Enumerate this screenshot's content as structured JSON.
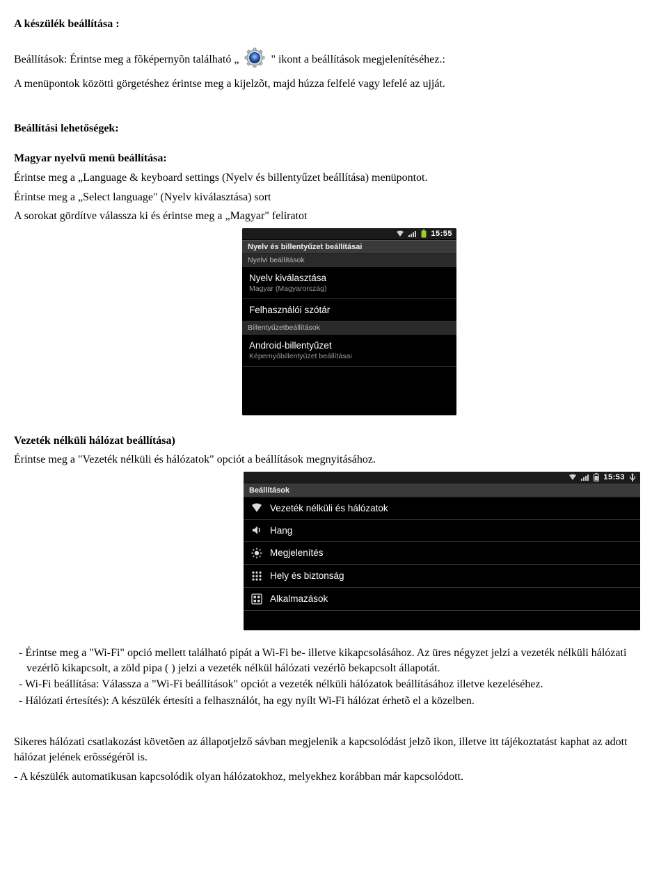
{
  "doc": {
    "h1": "A készülék beállítása :",
    "intro_pre": "Beállítások: Érintse meg a fõképernyõn található „",
    "intro_post": "\" ikont a beállítások megjelenítéséhez.:",
    "p2": "A menüpontok közötti görgetéshez érintse meg a kijelzõt, majd húzza felfelé vagy lefelé az ujját.",
    "h2": "Beállítási lehetőségek:",
    "h3a": "Magyar nyelvű menü beállítása:",
    "p3": "Érintse meg a „Language & keyboard settings (Nyelv és billentyűzet beállítása) menüpontot.",
    "p4": "Érintse meg a „Select language\" (Nyelv kiválasztása) sort",
    "p5": "A sorokat gördítve válassza ki és érintse meg a „Magyar\" feliratot",
    "h3b": "Vezeték nélküli hálózat beállítása)",
    "p6": "Érintse meg a \"Vezeték nélküli és hálózatok\" opciót a beállítások megnyitásához.",
    "b1": "- Érintse meg a \"Wi-Fi\" opció mellett található pipát a Wi-Fi be- illetve kikapcsolásához. Az üres négyzet jelzi a vezeték nélküli hálózati vezérlõ kikapcsolt, a zöld pipa ( ) jelzi a vezeték nélkül hálózati vezérlõ bekapcsolt állapotát.",
    "b2": "- Wi-Fi beállítása: Válassza a \"Wi-Fi beállítások\" opciót a vezeték nélküli hálózatok beállításához illetve kezeléséhez.",
    "b3": "- Hálózati értesítés): A készülék értesíti a felhasználót, ha egy nyílt Wi-Fi hálózat érhetõ el a közelben.",
    "p7": "Sikeres hálózati csatlakozást követõen az állapotjelző sávban megjelenik a kapcsolódást jelzõ ikon, illetve itt tájékoztatást kaphat az adott hálózat jelének erõsségérõl is.",
    "p8": "- A készülék automatikusan kapcsolódik olyan hálózatokhoz, melyekhez korábban már kapcsolódott."
  },
  "phone1": {
    "clock": "15:55",
    "title": "Nyelv és billentyűzet beállításai",
    "sec1": "Nyelvi beállítások",
    "row1": {
      "label": "Nyelv kiválasztása",
      "sub": "Magyar (Magyarország)"
    },
    "row2": {
      "label": "Felhasználói szótár"
    },
    "sec2": "Billentyűzetbeállítások",
    "row3": {
      "label": "Android-billentyűzet",
      "sub": "Képernyőbillentyűzet beállításai"
    }
  },
  "phone2": {
    "clock": "15:53",
    "title": "Beállítások",
    "row1": "Vezeték nélküli és hálózatok",
    "row2": "Hang",
    "row3": "Megjelenítés",
    "row4": "Hely és biztonság",
    "row5": "Alkalmazások"
  }
}
